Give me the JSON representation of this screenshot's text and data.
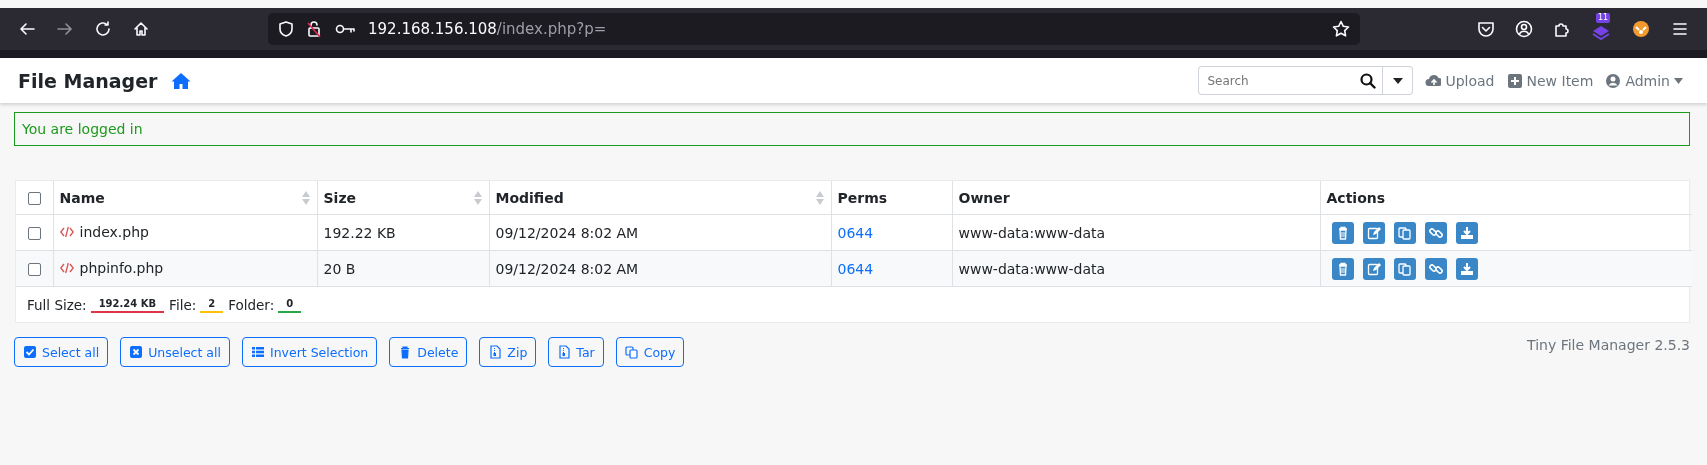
{
  "browser": {
    "url_host": "192.168.156.108",
    "url_path": "/index.php?p=",
    "extension_badge": "11"
  },
  "header": {
    "title": "File Manager",
    "search": {
      "placeholder": "Search"
    },
    "nav": [
      "Upload",
      "New Item",
      "Admin"
    ]
  },
  "alert": {
    "text": "You are logged in"
  },
  "table": {
    "select_all_checked": false,
    "columns": [
      {
        "label": "Name",
        "sortable": true
      },
      {
        "label": "Size",
        "sortable": true
      },
      {
        "label": "Modified",
        "sortable": true
      },
      {
        "label": "Perms",
        "sortable": false
      },
      {
        "label": "Owner",
        "sortable": false
      },
      {
        "label": "Actions",
        "sortable": false
      }
    ],
    "rows": [
      {
        "checked": false,
        "name": "index.php",
        "size": "192.22 KB",
        "modified": "09/12/2024 8:02 AM",
        "perms": "0644",
        "owner": "www-data:www-data"
      },
      {
        "checked": false,
        "name": "phpinfo.php",
        "size": "20 B",
        "modified": "09/12/2024 8:02 AM",
        "perms": "0644",
        "owner": "www-data:www-data"
      }
    ],
    "summary": [
      {
        "label": "Full Size:",
        "value": "192.24 KB",
        "color": "#dc3545"
      },
      {
        "label": "File:",
        "value": "2",
        "color": "#ffc107"
      },
      {
        "label": "Folder:",
        "value": "0",
        "color": "#28a745"
      }
    ]
  },
  "buttons": [
    "Select all",
    "Unselect all",
    "Invert Selection",
    "Delete",
    "Zip",
    "Tar",
    "Copy"
  ],
  "version": "Tiny File Manager 2.5.3"
}
